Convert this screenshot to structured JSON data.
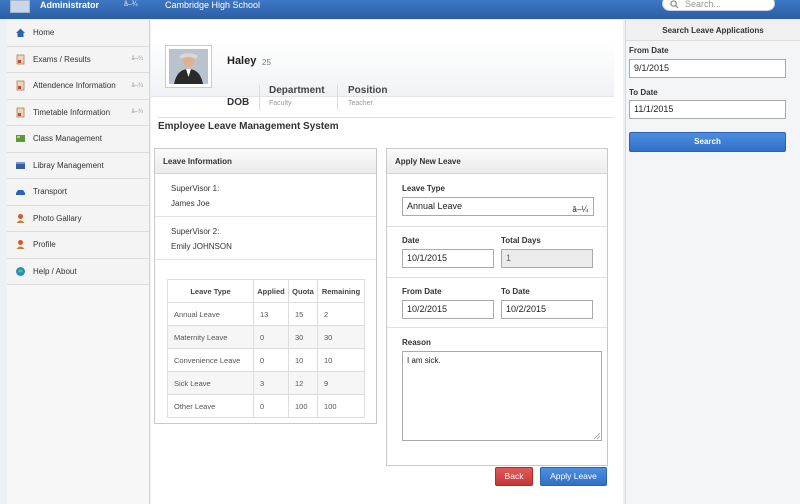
{
  "header": {
    "admin_name": "Administrator",
    "admin_flag": "â–¾",
    "school_name": "Cambridge High School",
    "search_placeholder": "Search..."
  },
  "sidebar": {
    "items": [
      {
        "label": "Home",
        "icon": "home-icon",
        "color": "#2a64b8",
        "flag": ""
      },
      {
        "label": "Exams / Results",
        "icon": "exam-icon",
        "color": "#c8a070",
        "flag": "â–¾"
      },
      {
        "label": "Attendence Information",
        "icon": "attendance-icon",
        "color": "#c8a070",
        "flag": "â–¾"
      },
      {
        "label": "Timetable Information",
        "icon": "timetable-icon",
        "color": "#c8a070",
        "flag": "â–¾"
      },
      {
        "label": "Class Management",
        "icon": "class-icon",
        "color": "#5a9a3a",
        "flag": ""
      },
      {
        "label": "Libray Management",
        "icon": "library-icon",
        "color": "#3a5aa0",
        "flag": ""
      },
      {
        "label": "Transport",
        "icon": "transport-icon",
        "color": "#2a64b8",
        "flag": ""
      },
      {
        "label": "Photo Gallary",
        "icon": "gallery-icon",
        "color": "#d05a2a",
        "flag": ""
      },
      {
        "label": "Profile",
        "icon": "profile-icon",
        "color": "#d05a2a",
        "flag": ""
      },
      {
        "label": "Help / About",
        "icon": "help-icon",
        "color": "#2a8ad0",
        "flag": ""
      }
    ]
  },
  "profile": {
    "name": "Haley",
    "age": "25",
    "dob_label": "DOB",
    "department_label": "Department",
    "department_value": "Faculty",
    "position_label": "Position",
    "position_value": "Teacher"
  },
  "system_title": "Employee Leave Management System",
  "leave_info": {
    "title": "Leave Information",
    "supervisor1_label": "SuperVisor 1:",
    "supervisor1_value": "James Joe",
    "supervisor2_label": "SuperVisor 2:",
    "supervisor2_value": "Emily JOHNSON",
    "columns": [
      "Leave Type",
      "Applied",
      "Quota",
      "Remaining"
    ],
    "rows": [
      [
        "Annual Leave",
        "13",
        "15",
        "2"
      ],
      [
        "Maternity Leave",
        "0",
        "30",
        "30"
      ],
      [
        "Convenience Leave",
        "0",
        "10",
        "10"
      ],
      [
        "Sick Leave",
        "3",
        "12",
        "9"
      ],
      [
        "Other Leave",
        "0",
        "100",
        "100"
      ]
    ]
  },
  "apply_leave": {
    "title": "Apply New Leave",
    "leave_type_label": "Leave Type",
    "leave_type_value": "Annual Leave",
    "date_label": "Date",
    "date_value": "10/1/2015",
    "total_days_label": "Total Days",
    "total_days_value": "1",
    "from_date_label": "From Date",
    "from_date_value": "10/2/2015",
    "to_date_label": "To Date",
    "to_date_value": "10/2/2015",
    "reason_label": "Reason",
    "reason_value": "I am sick.",
    "back_label": "Back",
    "apply_label": "Apply Leave"
  },
  "search_panel": {
    "title": "Search Leave Applications",
    "from_label": "From Date",
    "from_value": "9/1/2015",
    "to_label": "To Date",
    "to_value": "11/1/2015",
    "search_label": "Search"
  },
  "colors": {
    "topbar": "#2f66ad",
    "primary_button": "#3a7bd5",
    "danger_button": "#d64545"
  }
}
